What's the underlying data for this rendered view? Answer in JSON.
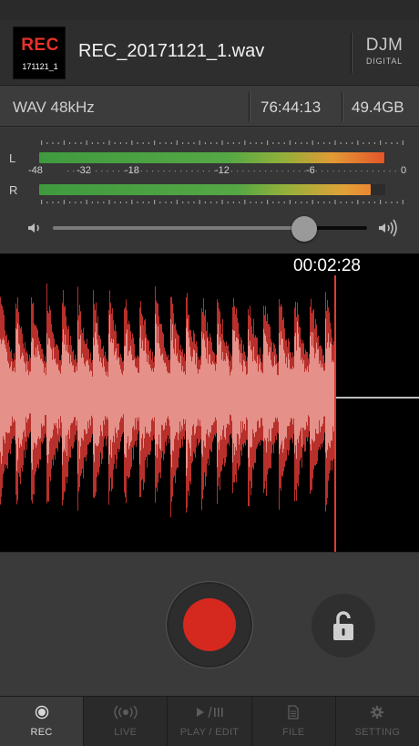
{
  "header": {
    "rec_badge_label": "REC",
    "rec_badge_sublabel": "171121_1",
    "file_name": "REC_20171121_1.wav",
    "brand_top": "DJM",
    "brand_bottom": "DIGITAL"
  },
  "info": {
    "format": "WAV 48kHz",
    "remaining_time": "76:44:13",
    "free_space": "49.4GB"
  },
  "meters": {
    "left_label": "L",
    "right_label": "R",
    "left_level": 0.98,
    "right_level": 0.94,
    "scale_labels": [
      "-48",
      "-32",
      "-18",
      "-12",
      "-6",
      "0"
    ]
  },
  "volume": {
    "level": 0.8,
    "icon_low": "speaker-low-icon",
    "icon_high": "speaker-high-icon"
  },
  "waveform": {
    "time": "00:02:28",
    "progress": 0.8,
    "color_outer": "#b8302b",
    "color_inner": "#e6908a",
    "playhead_color": "#e03a30"
  },
  "controls": {
    "record_color": "#d5281f",
    "lock_icon": "unlock-icon"
  },
  "tabs": [
    {
      "label": "REC",
      "icon": "record-icon",
      "active": true
    },
    {
      "label": "LIVE",
      "icon": "broadcast-icon",
      "active": false
    },
    {
      "label": "PLAY / EDIT",
      "icon": "play-pause-icon",
      "active": false
    },
    {
      "label": "FILE",
      "icon": "file-icon",
      "active": false
    },
    {
      "label": "SETTING",
      "icon": "gear-icon",
      "active": false
    }
  ]
}
